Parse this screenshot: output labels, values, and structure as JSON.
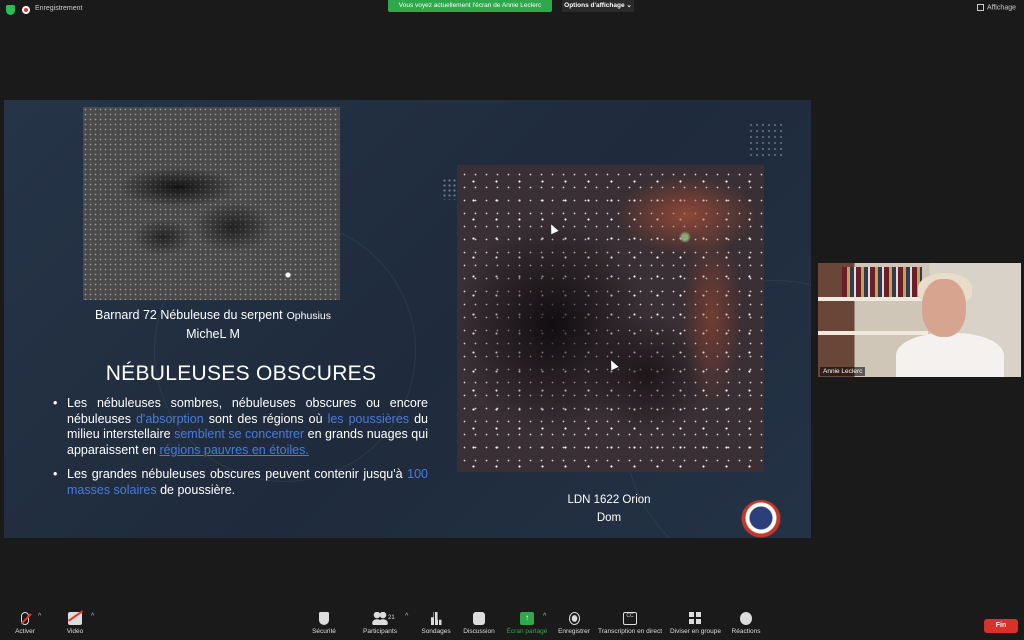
{
  "topbar": {
    "recording_label": "Enregistrement",
    "viewing_banner": "Vous voyez actuellement l'écran de Annie Leclerc",
    "view_options_label": "Options d'affichage",
    "view_options_caret": "⌄",
    "affichage_label": "Affichage"
  },
  "slide": {
    "caption_left_line1": "Barnard 72 Nébuleuse du serpent",
    "caption_left_ophiuchus": "Ophusius",
    "caption_left_line2": "MicheL M",
    "caption_right_line1": "LDN 1622 Orion",
    "caption_right_line2": "Dom",
    "title": "NÉBULEUSES OBSCURES",
    "bullet1": {
      "t1": "Les nébuleuses sombres, nébuleuses obscures ou encore nébuleuses ",
      "h1": "d'absorption",
      "t2": " sont des régions où ",
      "h2": "les poussières",
      "t3": " du milieu interstellaire ",
      "h3": "semblent se concentrer",
      "t4": " en grands nuages qui apparaissent en ",
      "h4": "régions pauvres en étoiles."
    },
    "bullet2": {
      "t1": "Les grandes nébuleuses obscures peuvent contenir jusqu'à ",
      "h1": "100 masses solaires",
      "t2": " de poussière."
    }
  },
  "participant": {
    "name": "Annie Leclerc"
  },
  "toolbar": {
    "mute_label": "Activer",
    "video_label": "Vidéo",
    "security_label": "Sécurité",
    "participants_label": "Participants",
    "participants_count": "21",
    "polls_label": "Sondages",
    "chat_label": "Discussion",
    "share_label": "Écran partagé",
    "record_label": "Enregistrer",
    "transcript_label": "Transcription en direct",
    "breakout_label": "Diviser en groupe",
    "reactions_label": "Réactions",
    "end_label": "Fin",
    "caret": "^",
    "cc_glyph": "CC",
    "share_glyph": "↑"
  }
}
